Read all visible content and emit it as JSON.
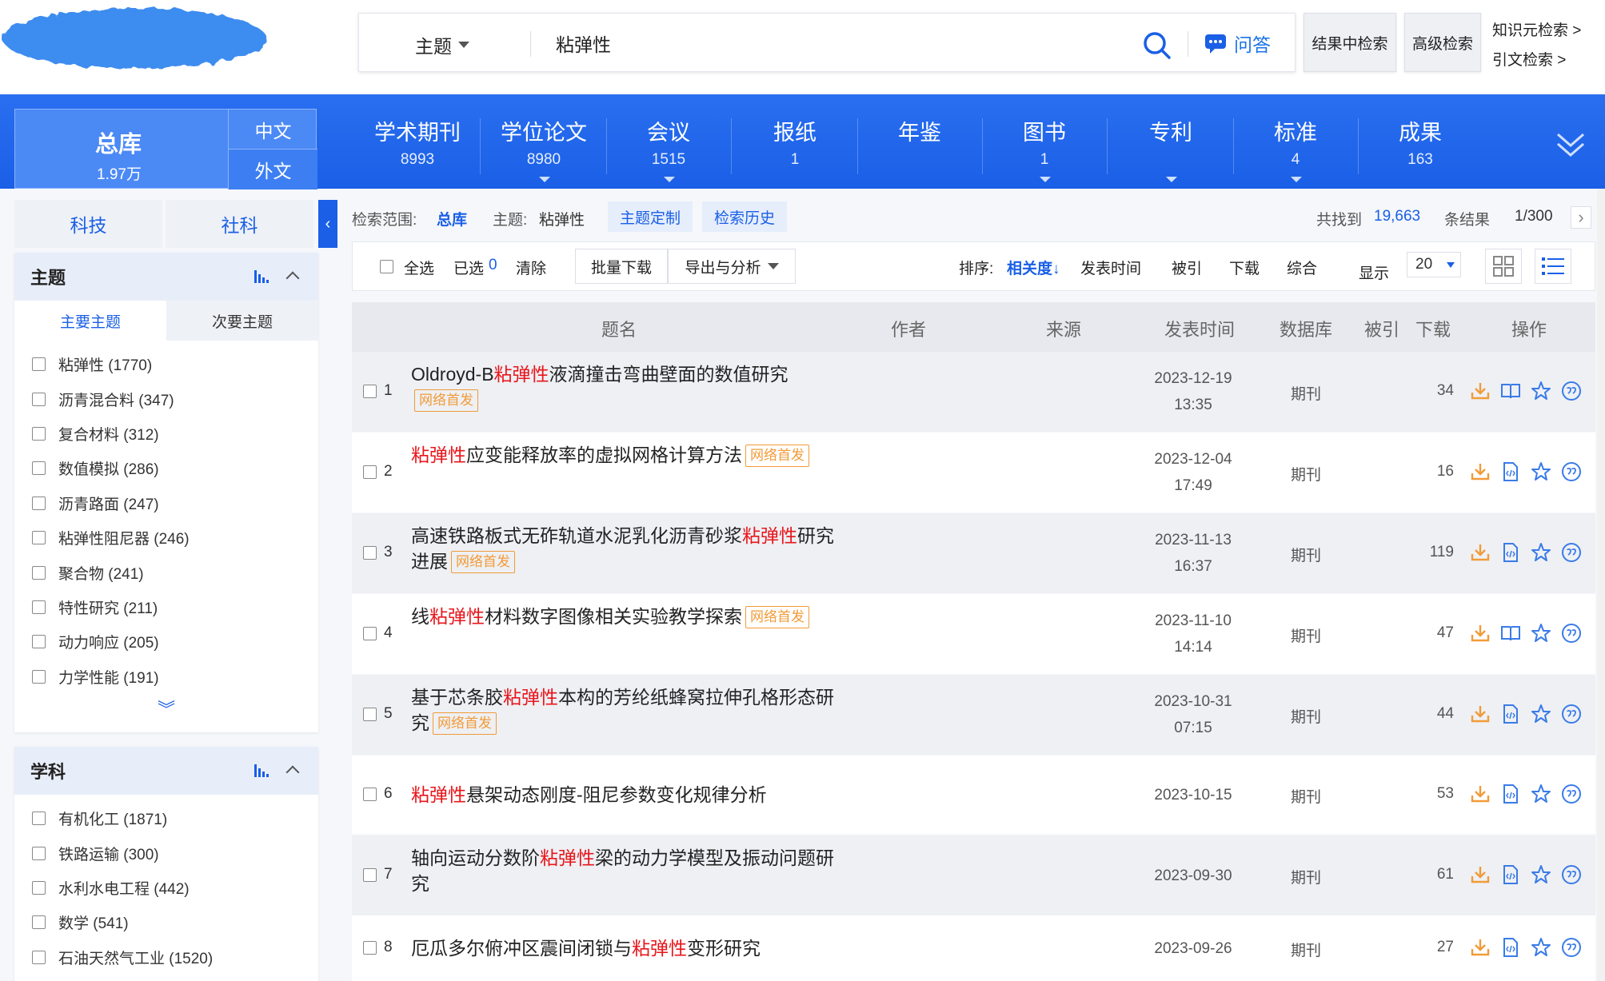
{
  "search": {
    "field": "主题",
    "query": "粘弹性",
    "qa_label": "问答",
    "in_results_label": "结果中检索",
    "advanced_label": "高级检索",
    "knowledge_label": "知识元检索 >",
    "citation_label": "引文检索 >"
  },
  "nav": {
    "total_label": "总库",
    "total_count": "1.97万",
    "lang_cn": "中文",
    "lang_foreign": "外文",
    "items": [
      {
        "label": "学术期刊",
        "count": "8993"
      },
      {
        "label": "学位论文",
        "count": "8980"
      },
      {
        "label": "会议",
        "count": "1515"
      },
      {
        "label": "报纸",
        "count": "1"
      },
      {
        "label": "年鉴",
        "count": ""
      },
      {
        "label": "图书",
        "count": "1"
      },
      {
        "label": "专利",
        "count": ""
      },
      {
        "label": "标准",
        "count": "4"
      },
      {
        "label": "成果",
        "count": "163"
      }
    ]
  },
  "sidebar": {
    "tab_sci": "科技",
    "tab_soc": "社科",
    "topic": {
      "title": "主题",
      "sub_main": "主要主题",
      "sub_minor": "次要主题",
      "items": [
        "粘弹性 (1770)",
        "沥青混合料 (347)",
        "复合材料 (312)",
        "数值模拟 (286)",
        "沥青路面 (247)",
        "粘弹性阻尼器 (246)",
        "聚合物 (241)",
        "特性研究 (211)",
        "动力响应 (205)",
        "力学性能 (191)"
      ],
      "more": "︾"
    },
    "subject": {
      "title": "学科",
      "items": [
        "有机化工 (1871)",
        "铁路运输 (300)",
        "水利水电工程 (442)",
        "数学 (541)",
        "石油天然气工业 (1520)"
      ]
    }
  },
  "crumb": {
    "scope_label": "检索范围:",
    "scope_value": "总库",
    "topic_label": "主题:",
    "topic_value": "粘弹性",
    "custom_label": "主题定制",
    "history_label": "检索历史",
    "found_prefix": "共找到",
    "found_count": "19,663",
    "found_suffix": "条结果",
    "page": "1/300",
    "next": "›"
  },
  "toolbar": {
    "select_all": "全选",
    "selected_label": "已选",
    "selected_count": "0",
    "clear": "清除",
    "batch_download": "批量下载",
    "export": "导出与分析",
    "sort_label": "排序:",
    "sort_relevance": "相关度",
    "sort_date": "发表时间",
    "sort_cited": "被引",
    "sort_download": "下载",
    "sort_overall": "综合",
    "show_label": "显示",
    "page_size": "20"
  },
  "table": {
    "headers": {
      "title": "题名",
      "author": "作者",
      "source": "来源",
      "date": "发表时间",
      "db": "数据库",
      "cited": "被引",
      "download": "下载",
      "ops": "操作"
    },
    "tag": "网络首发",
    "rows": [
      {
        "num": "1",
        "pre": "Oldroyd-B",
        "hl": "粘弹性",
        "post": "液滴撞击弯曲壁面的数值研究",
        "tag": true,
        "date": "2023-12-19",
        "time": "13:35",
        "db": "期刊",
        "dl": "34"
      },
      {
        "num": "2",
        "pre": "",
        "hl": "粘弹性",
        "post": "应变能释放率的虚拟网格计算方法",
        "tag": true,
        "date": "2023-12-04",
        "time": "17:49",
        "db": "期刊",
        "dl": "16"
      },
      {
        "num": "3",
        "pre": "高速铁路板式无砟轨道水泥乳化沥青砂浆",
        "hl": "粘弹性",
        "post": "研究进展",
        "tag": true,
        "date": "2023-11-13",
        "time": "16:37",
        "db": "期刊",
        "dl": "119"
      },
      {
        "num": "4",
        "pre": "线",
        "hl": "粘弹性",
        "post": "材料数字图像相关实验教学探索",
        "tag": true,
        "date": "2023-11-10",
        "time": "14:14",
        "db": "期刊",
        "dl": "47"
      },
      {
        "num": "5",
        "pre": "基于芯条胶",
        "hl": "粘弹性",
        "post": "本构的芳纶纸蜂窝拉伸孔格形态研究",
        "tag": true,
        "date": "2023-10-31",
        "time": "07:15",
        "db": "期刊",
        "dl": "44"
      },
      {
        "num": "6",
        "pre": "",
        "hl": "粘弹性",
        "post": "悬架动态刚度-阻尼参数变化规律分析",
        "tag": false,
        "date": "2023-10-15",
        "time": "",
        "db": "期刊",
        "dl": "53"
      },
      {
        "num": "7",
        "pre": "轴向运动分数阶",
        "hl": "粘弹性",
        "post": "梁的动力学模型及振动问题研究",
        "tag": false,
        "date": "2023-09-30",
        "time": "",
        "db": "期刊",
        "dl": "61"
      },
      {
        "num": "8",
        "pre": "厄瓜多尔俯冲区震间闭锁与",
        "hl": "粘弹性",
        "post": "变形研究",
        "tag": false,
        "date": "2023-09-26",
        "time": "",
        "db": "期刊",
        "dl": "27"
      }
    ]
  },
  "colors": {
    "brand": "#1a5fe6",
    "highlight": "#e8161b",
    "tag": "#f29b38",
    "download_icon": "#f29b38"
  }
}
